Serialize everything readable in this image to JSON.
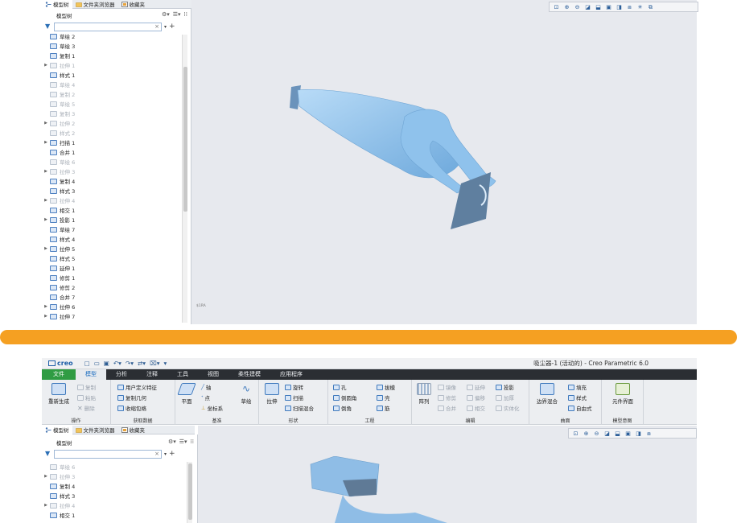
{
  "top_panel": {
    "tabs": [
      {
        "label": "模型树",
        "icon": "model-tree-icon"
      },
      {
        "label": "文件夹浏览器",
        "icon": "folder-icon"
      },
      {
        "label": "收藏夹",
        "icon": "favorites-icon"
      }
    ],
    "tree_header": "模型树",
    "search_placeholder": "",
    "tree_items": [
      {
        "label": "草绘 2",
        "expander": false,
        "dim": false
      },
      {
        "label": "草绘 3",
        "expander": false,
        "dim": false
      },
      {
        "label": "复制 1",
        "expander": false,
        "dim": false
      },
      {
        "label": "拉伸 1",
        "expander": true,
        "dim": true
      },
      {
        "label": "样式 1",
        "expander": false,
        "dim": false
      },
      {
        "label": "草绘 4",
        "expander": false,
        "dim": true
      },
      {
        "label": "复制 2",
        "expander": false,
        "dim": true
      },
      {
        "label": "草绘 5",
        "expander": false,
        "dim": true
      },
      {
        "label": "复制 3",
        "expander": false,
        "dim": true
      },
      {
        "label": "拉伸 2",
        "expander": true,
        "dim": true
      },
      {
        "label": "样式 2",
        "expander": false,
        "dim": true
      },
      {
        "label": "扫描 1",
        "expander": true,
        "dim": false
      },
      {
        "label": "合并 1",
        "expander": false,
        "dim": false
      },
      {
        "label": "草绘 6",
        "expander": false,
        "dim": true
      },
      {
        "label": "拉伸 3",
        "expander": true,
        "dim": true
      },
      {
        "label": "复制 4",
        "expander": false,
        "dim": false
      },
      {
        "label": "样式 3",
        "expander": false,
        "dim": false
      },
      {
        "label": "拉伸 4",
        "expander": true,
        "dim": true
      },
      {
        "label": "相交 1",
        "expander": false,
        "dim": false
      },
      {
        "label": "投影 1",
        "expander": true,
        "dim": false
      },
      {
        "label": "草绘 7",
        "expander": false,
        "dim": false
      },
      {
        "label": "样式 4",
        "expander": false,
        "dim": false
      },
      {
        "label": "拉伸 5",
        "expander": true,
        "dim": false
      },
      {
        "label": "样式 5",
        "expander": false,
        "dim": false
      },
      {
        "label": "延伸 1",
        "expander": false,
        "dim": false
      },
      {
        "label": "修剪 1",
        "expander": false,
        "dim": false
      },
      {
        "label": "修剪 2",
        "expander": false,
        "dim": false
      },
      {
        "label": "合并 7",
        "expander": false,
        "dim": false
      },
      {
        "label": "拉伸 6",
        "expander": true,
        "dim": false
      },
      {
        "label": "拉伸 7",
        "expander": true,
        "dim": false
      }
    ],
    "tiny_label": "$1RA"
  },
  "bottom_panel": {
    "logo": "creo",
    "window_title": "吸尘器-1 (活动的) - Creo Parametric 6.0",
    "menu": [
      "文件",
      "模型",
      "分析",
      "注释",
      "工具",
      "视图",
      "柔性建模",
      "应用程序"
    ],
    "active_menu": "模型",
    "ribbon": {
      "operations": {
        "label": "操作",
        "regen": "重新生成",
        "copy": "复制",
        "paste": "粘贴",
        "delete": "删除"
      },
      "get_data": {
        "label": "获取数据",
        "udf": "用户定义特征",
        "copy_geom": "复制几何",
        "shrinkwrap": "收缩包络"
      },
      "datum": {
        "label": "基准",
        "plane": "平面",
        "axis": "轴",
        "point": "点",
        "csys": "坐标系",
        "sketch": "草绘"
      },
      "shapes": {
        "label": "形状",
        "extrude": "拉伸",
        "revolve": "旋转",
        "sweep": "扫描",
        "swept_blend": "扫描混合"
      },
      "engineering": {
        "label": "工程",
        "hole": "孔",
        "round": "倒圆角",
        "chamfer": "倒角",
        "draft": "拔模",
        "shell": "壳",
        "rib": "筋"
      },
      "editing": {
        "label": "编辑",
        "pattern": "阵列",
        "mirror": "镜像",
        "extend": "延伸",
        "project": "投影",
        "trim": "修剪",
        "offset": "偏移",
        "thicken": "加厚",
        "merge": "合并",
        "intersect": "相交",
        "solidify": "实体化"
      },
      "surfaces": {
        "label": "曲面",
        "boundary": "边界混合",
        "fill": "填充",
        "style": "样式",
        "freestyle": "自由式"
      },
      "model_intent": {
        "label": "模型意图",
        "component_interface": "元件界面"
      }
    },
    "tabs": [
      {
        "label": "模型树"
      },
      {
        "label": "文件夹浏览器"
      },
      {
        "label": "收藏夹"
      }
    ],
    "tree_header": "模型树",
    "tree_items": [
      {
        "label": "草绘 6",
        "expander": false,
        "dim": true
      },
      {
        "label": "拉伸 3",
        "expander": true,
        "dim": true
      },
      {
        "label": "复制 4",
        "expander": false,
        "dim": false
      },
      {
        "label": "样式 3",
        "expander": false,
        "dim": false
      },
      {
        "label": "拉伸 4",
        "expander": true,
        "dim": true
      },
      {
        "label": "相交 1",
        "expander": false,
        "dim": false
      }
    ]
  },
  "colors": {
    "accent_orange": "#f5a022",
    "file_tab_green": "#2f9c43",
    "menubar_dark": "#2b2e33",
    "model_blue": "#9ac8ef"
  }
}
